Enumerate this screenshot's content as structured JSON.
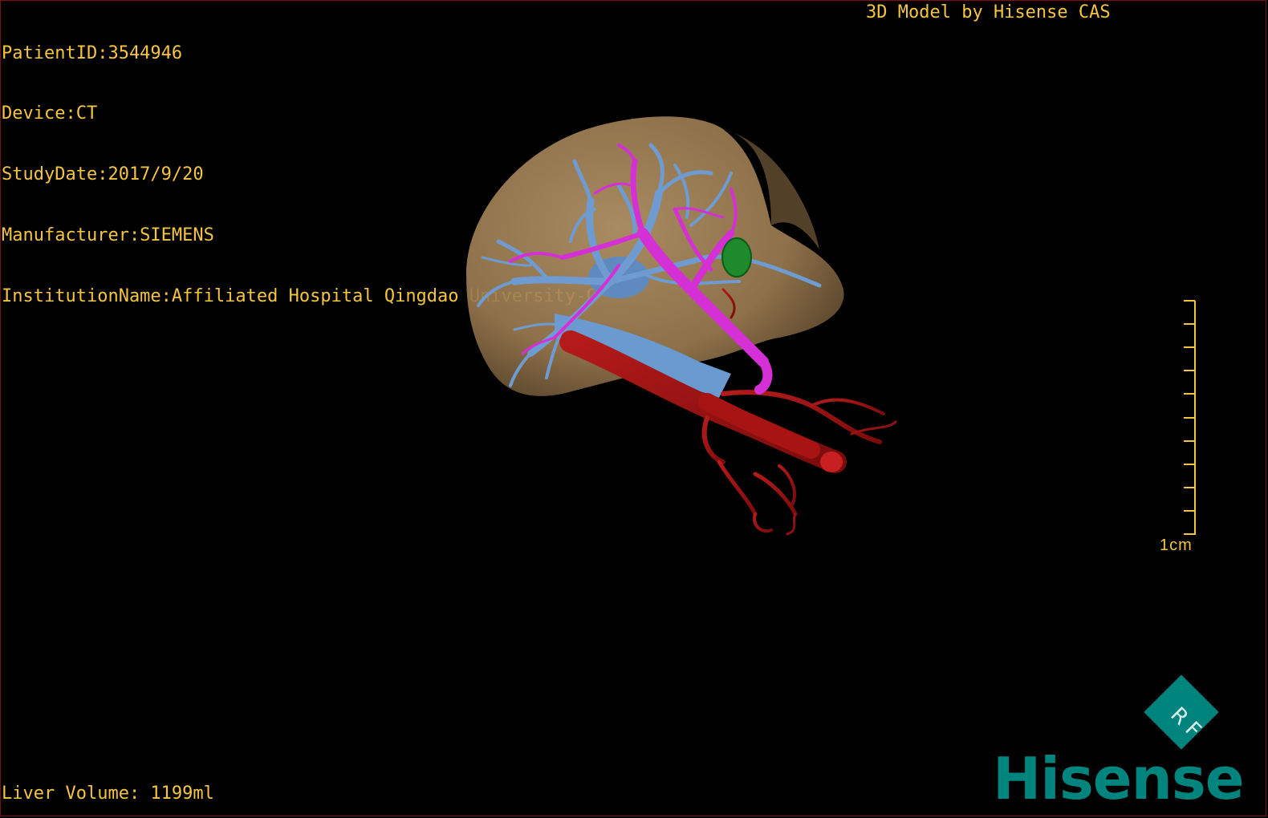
{
  "overlay": {
    "patient_id": "PatientID:3544946",
    "device": "Device:CT",
    "study_date": "StudyDate:2017/9/20",
    "manufacturer": "Manufacturer:SIEMENS",
    "institution": "InstitutionName:Affiliated Hospital Qingdao University-C",
    "brand_text": "3D Model by Hisense CAS",
    "liver_volume": "Liver Volume: 1199ml"
  },
  "scale": {
    "label": "1cm",
    "ticks": 10
  },
  "logo": {
    "rf_letters": "RF",
    "company": "Hisense",
    "brand_color": "#00847e"
  },
  "colors": {
    "overlay_text": "#f5c542",
    "liver": "#a58459",
    "portal_vein": "#6e9cd2",
    "hepatic_vein": "#d52fd6",
    "artery": "#a31313",
    "lesion": "#1f8a2c",
    "frame_border": "#7a1010"
  },
  "icons": [
    "rf-diamond-icon",
    "scale-bar-icon"
  ]
}
